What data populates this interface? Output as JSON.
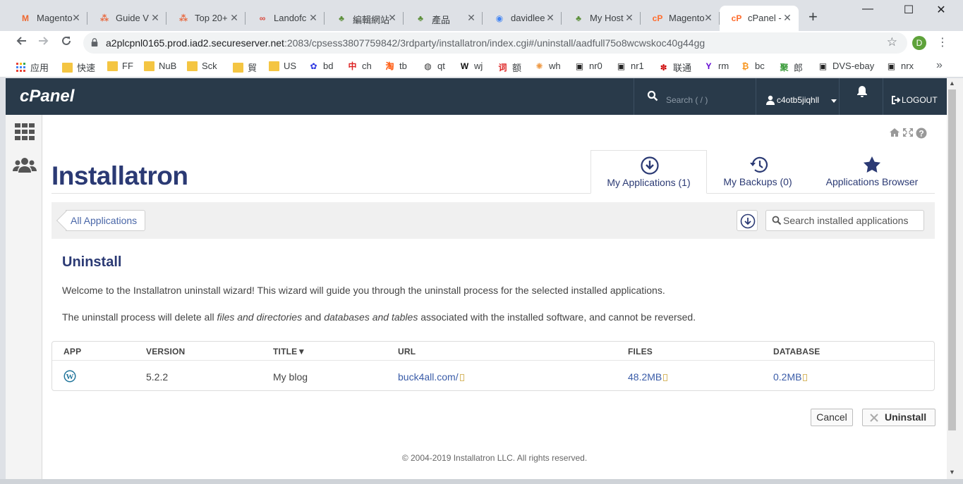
{
  "browser": {
    "tabs": [
      {
        "title": "Magento",
        "favicon": "magento-icon",
        "color": "#ee672f",
        "glyph": "M"
      },
      {
        "title": "Guide V",
        "favicon": "dots-icon",
        "color": "#e8653a",
        "glyph": "⁂"
      },
      {
        "title": "Top 20+",
        "favicon": "dots-icon",
        "color": "#e8653a",
        "glyph": "⁂"
      },
      {
        "title": "Landofc",
        "favicon": "glasses-icon",
        "color": "#d9473b",
        "glyph": "∞"
      },
      {
        "title": "編輯網站",
        "favicon": "tree-icon",
        "color": "#5c8f3a",
        "glyph": "♣"
      },
      {
        "title": "產品",
        "favicon": "tree-icon",
        "color": "#5c8f3a",
        "glyph": "♣"
      },
      {
        "title": "davidlee",
        "favicon": "chrome-icon",
        "color": "#4285f4",
        "glyph": "◉"
      },
      {
        "title": "My Host",
        "favicon": "tree-icon",
        "color": "#5c8f3a",
        "glyph": "♣"
      },
      {
        "title": "Magento",
        "favicon": "cpanel-icon",
        "color": "#ff6c2c",
        "glyph": "cP"
      },
      {
        "title": "cPanel -",
        "favicon": "cpanel-icon",
        "color": "#ff6c2c",
        "glyph": "cP",
        "active": true
      }
    ],
    "new_tab": "+",
    "window_controls": {
      "minimize": "—",
      "maximize": "☐",
      "close": "✕"
    },
    "url_host": "a2plcpnl0165.prod.iad2.secureserver.net",
    "url_rest": ":2083/cpsess3807759842/3rdparty/installatron/index.cgi#/uninstall/aadfull75o8wcwskoc40g44gg",
    "profile_initial": "D",
    "bookmarks": [
      {
        "label": "应用",
        "icon": "apps-grid-icon",
        "color": "#4285f4"
      },
      {
        "label": "快速",
        "icon": "folder-icon"
      },
      {
        "label": "FF",
        "icon": "folder-icon"
      },
      {
        "label": "NuB",
        "icon": "folder-icon"
      },
      {
        "label": "Sck",
        "icon": "folder-icon"
      },
      {
        "label": "貿",
        "icon": "folder-icon"
      },
      {
        "label": "US",
        "icon": "folder-icon"
      },
      {
        "label": "bd",
        "icon": "paw-icon",
        "color": "#2932e1",
        "glyph": "✿"
      },
      {
        "label": "ch",
        "icon": "ch-icon",
        "color": "#d22",
        "glyph": "中"
      },
      {
        "label": "tb",
        "icon": "taobao-icon",
        "color": "#ff5000",
        "glyph": "淘"
      },
      {
        "label": "qt",
        "icon": "globe-icon",
        "color": "#333",
        "glyph": "◍"
      },
      {
        "label": "wj",
        "icon": "w-icon",
        "color": "#111",
        "glyph": "W"
      },
      {
        "label": "额",
        "icon": "ci-icon",
        "color": "#d22",
        "glyph": "词"
      },
      {
        "label": "wh",
        "icon": "pinwheel-icon",
        "color": "#e94",
        "glyph": "✺"
      },
      {
        "label": "nr0",
        "icon": "tv-icon",
        "color": "#222",
        "glyph": "▣"
      },
      {
        "label": "nr1",
        "icon": "tv-icon",
        "color": "#222",
        "glyph": "▣"
      },
      {
        "label": "联通",
        "icon": "unicom-icon",
        "color": "#c00",
        "glyph": "✽"
      },
      {
        "label": "rm",
        "icon": "yahoo-icon",
        "color": "#5f01d1",
        "glyph": "Y"
      },
      {
        "label": "bc",
        "icon": "bitcoin-icon",
        "color": "#f7931a",
        "glyph": "₿"
      },
      {
        "label": "郎",
        "icon": "ju-icon",
        "color": "#3a9b3a",
        "glyph": "聚"
      },
      {
        "label": "DVS-ebay",
        "icon": "tv-icon",
        "color": "#222",
        "glyph": "▣"
      },
      {
        "label": "nrx",
        "icon": "tv-icon",
        "color": "#222",
        "glyph": "▣"
      }
    ],
    "bookmarks_more": "»"
  },
  "cpanel": {
    "logo": "cPanel",
    "search_placeholder": "Search ( / )",
    "username": "c4otb5jiqhll",
    "logout_label": "LOGOUT"
  },
  "installatron": {
    "logo": "Installatron",
    "tabs": [
      {
        "label": "My Applications (1)",
        "icon": "download-circle-icon",
        "active": true
      },
      {
        "label": "My Backups (0)",
        "icon": "history-icon",
        "active": false
      },
      {
        "label": "Applications Browser",
        "icon": "star-icon",
        "active": false
      }
    ],
    "breadcrumb": "All Applications",
    "search_placeholder": "Search installed applications",
    "heading": "Uninstall",
    "intro": "Welcome to the Installatron uninstall wizard! This wizard will guide you through the uninstall process for the selected installed applications.",
    "warning": {
      "part1": "The uninstall process will delete all ",
      "em1": "files and directories",
      "part2": " and ",
      "em2": "databases and tables",
      "part3": " associated with the installed software, and cannot be reversed."
    },
    "table": {
      "headers": [
        "APP",
        "VERSION",
        "TITLE▼",
        "URL",
        "FILES",
        "DATABASE"
      ],
      "rows": [
        {
          "app_icon": "wordpress-icon",
          "version": "5.2.2",
          "title": "My blog",
          "url": "buck4all.com/",
          "files": "48.2MB",
          "database": "0.2MB"
        }
      ]
    },
    "cancel_label": "Cancel",
    "uninstall_label": "Uninstall",
    "footer": "© 2004-2019 Installatron LLC. All rights reserved."
  },
  "colors": {
    "cpanel_header": "#293a4a",
    "installatron_navy": "#2b3a74",
    "link_blue": "#3a5ca8",
    "chrome_frame": "#dee1e6"
  }
}
